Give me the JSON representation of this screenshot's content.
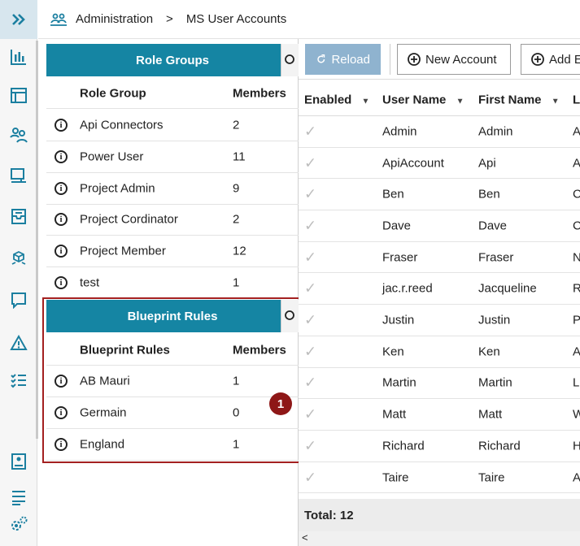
{
  "breadcrumb": {
    "section": "Administration",
    "separator": ">",
    "page": "MS User Accounts"
  },
  "sidebar": {
    "items": [
      "expand",
      "charts",
      "calendar",
      "users",
      "computer",
      "inbox",
      "blueprint",
      "chat",
      "alert",
      "checklist",
      "report",
      "list",
      "settings"
    ]
  },
  "role_groups": {
    "title": "Role Groups",
    "columns": [
      "Role Group",
      "Members"
    ],
    "rows": [
      {
        "name": "Api Connectors",
        "members": "2"
      },
      {
        "name": "Power User",
        "members": "11"
      },
      {
        "name": "Project Admin",
        "members": "9"
      },
      {
        "name": "Project Cordinator",
        "members": "2"
      },
      {
        "name": "Project Member",
        "members": "12"
      },
      {
        "name": "test",
        "members": "1"
      }
    ]
  },
  "blueprint_rules": {
    "title": "Blueprint Rules",
    "columns": [
      "Blueprint Rules",
      "Members"
    ],
    "rows": [
      {
        "name": "AB Mauri",
        "members": "1"
      },
      {
        "name": "Germain",
        "members": "0"
      },
      {
        "name": "England",
        "members": "1"
      }
    ]
  },
  "callout": {
    "number": "1",
    "color": "#8e1717"
  },
  "toolbar": {
    "reload": "Reload",
    "new_account": "New Account",
    "add": "Add E"
  },
  "users": {
    "columns": {
      "enabled": "Enabled",
      "user_name": "User Name",
      "first_name": "First Name",
      "last": "L"
    },
    "rows": [
      {
        "user": "Admin",
        "first": "Admin",
        "last": "A"
      },
      {
        "user": "ApiAccount",
        "first": "Api",
        "last": "A"
      },
      {
        "user": "Ben",
        "first": "Ben",
        "last": "C"
      },
      {
        "user": "Dave",
        "first": "Dave",
        "last": "C"
      },
      {
        "user": "Fraser",
        "first": "Fraser",
        "last": "N"
      },
      {
        "user": "jac.r.reed",
        "first": "Jacqueline",
        "last": "R"
      },
      {
        "user": "Justin",
        "first": "Justin",
        "last": "P"
      },
      {
        "user": "Ken",
        "first": "Ken",
        "last": "A"
      },
      {
        "user": "Martin",
        "first": "Martin",
        "last": "L"
      },
      {
        "user": "Matt",
        "first": "Matt",
        "last": "W"
      },
      {
        "user": "Richard",
        "first": "Richard",
        "last": "H"
      },
      {
        "user": "Taire",
        "first": "Taire",
        "last": "A"
      }
    ],
    "total": "Total: 12"
  },
  "colors": {
    "accent": "#1585a3",
    "highlight": "#a32020",
    "icon": "#1b7fa0"
  }
}
